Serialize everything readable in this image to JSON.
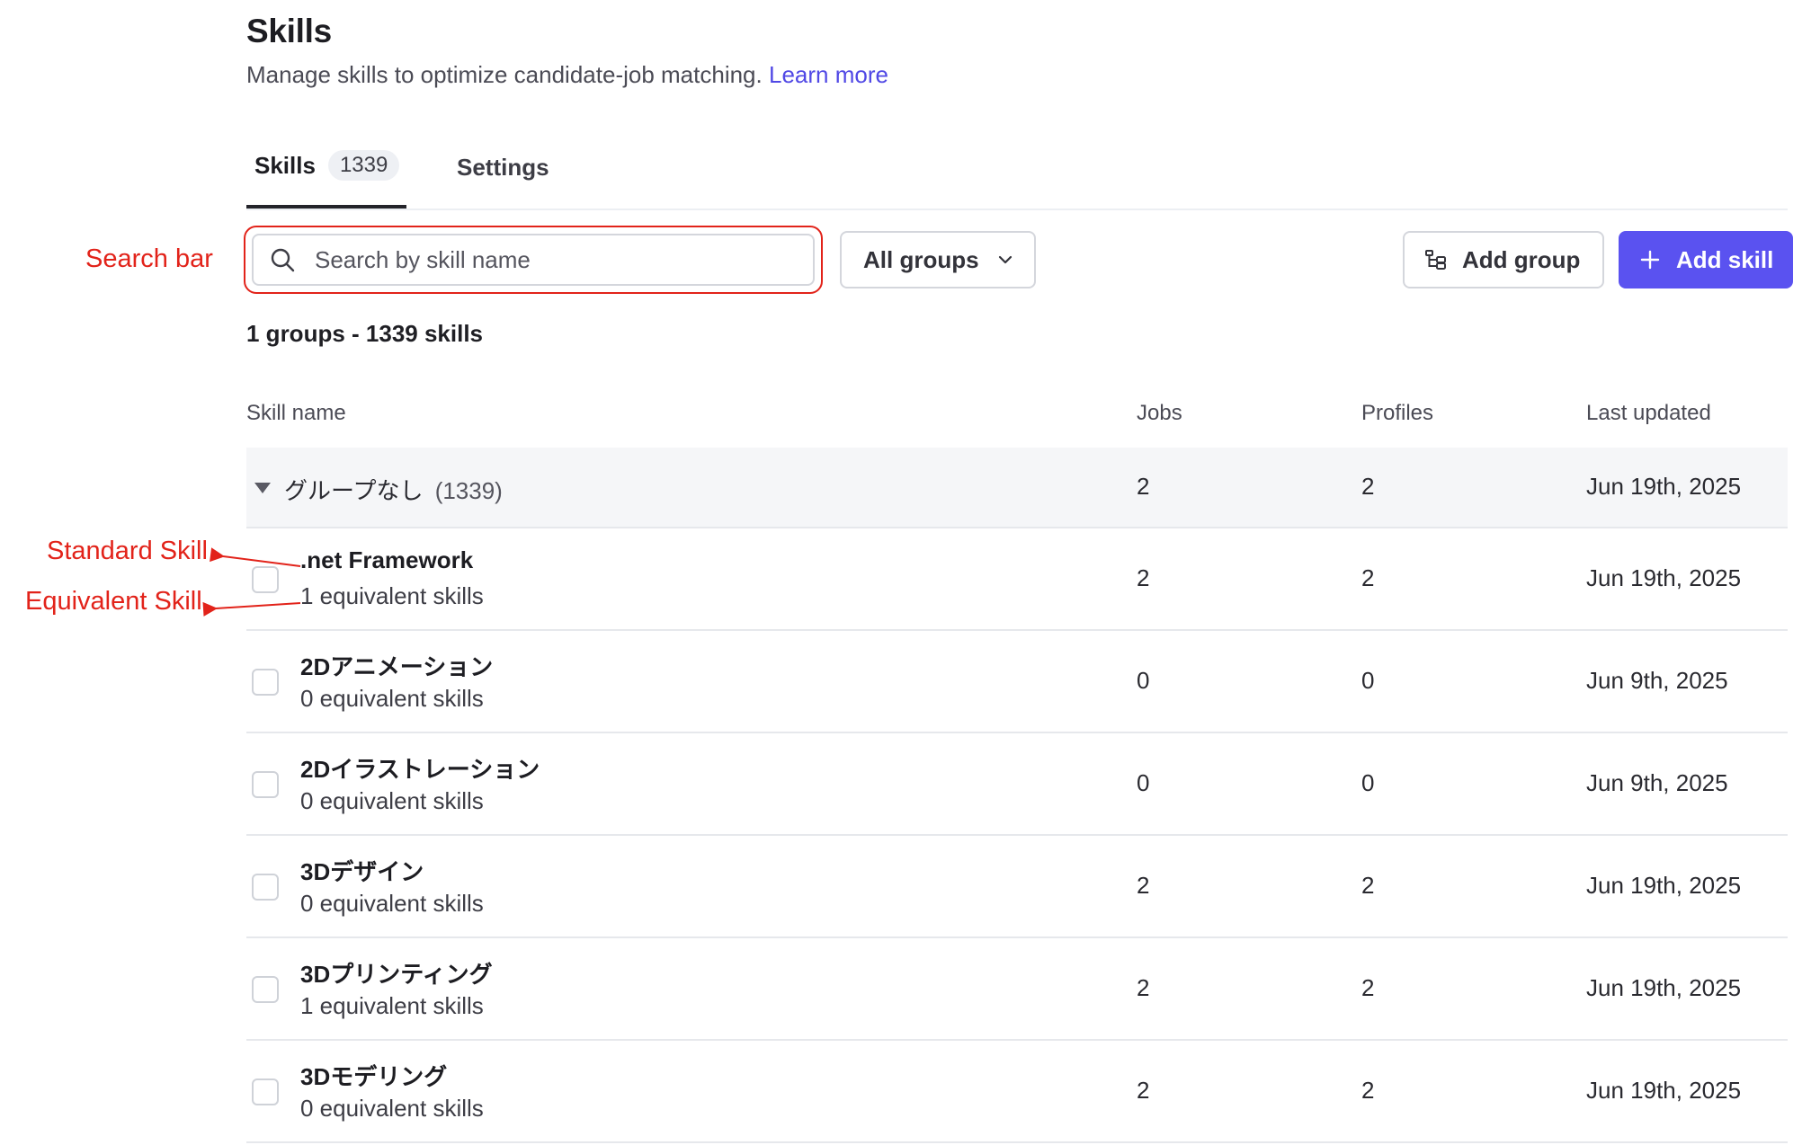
{
  "header": {
    "title": "Skills",
    "subtitle": "Manage skills to optimize candidate-job matching.",
    "learn_more": "Learn more"
  },
  "tabs": [
    {
      "label": "Skills",
      "count": "1339"
    },
    {
      "label": "Settings"
    }
  ],
  "toolbar": {
    "search_placeholder": "Search by skill name",
    "groups_select": "All groups",
    "add_group": "Add group",
    "add_skill": "Add skill"
  },
  "summary": "1 groups - 1339 skills",
  "table": {
    "columns": [
      "Skill name",
      "Jobs",
      "Profiles",
      "Last updated"
    ],
    "group": {
      "name": "グループなし",
      "count": "(1339)",
      "jobs": "2",
      "profiles": "2",
      "updated": "Jun 19th, 2025"
    },
    "rows": [
      {
        "name": ".net Framework",
        "equiv": "1 equivalent skills",
        "jobs": "2",
        "profiles": "2",
        "updated": "Jun 19th, 2025"
      },
      {
        "name": "2Dアニメーション",
        "equiv": "0 equivalent skills",
        "jobs": "0",
        "profiles": "0",
        "updated": "Jun 9th, 2025"
      },
      {
        "name": "2Dイラストレーション",
        "equiv": "0 equivalent skills",
        "jobs": "0",
        "profiles": "0",
        "updated": "Jun 9th, 2025"
      },
      {
        "name": "3Dデザイン",
        "equiv": "0 equivalent skills",
        "jobs": "2",
        "profiles": "2",
        "updated": "Jun 19th, 2025"
      },
      {
        "name": "3Dプリンティング",
        "equiv": "1 equivalent skills",
        "jobs": "2",
        "profiles": "2",
        "updated": "Jun 19th, 2025"
      },
      {
        "name": "3Dモデリング",
        "equiv": "0 equivalent skills",
        "jobs": "2",
        "profiles": "2",
        "updated": "Jun 19th, 2025"
      }
    ]
  },
  "annotations": {
    "search_bar": "Search bar",
    "standard_skill": "Standard Skill",
    "equivalent_skill": "Equivalent Skill",
    "color": "#e2231a"
  },
  "colors": {
    "accent": "#5a52f0",
    "link": "#5048e5"
  }
}
